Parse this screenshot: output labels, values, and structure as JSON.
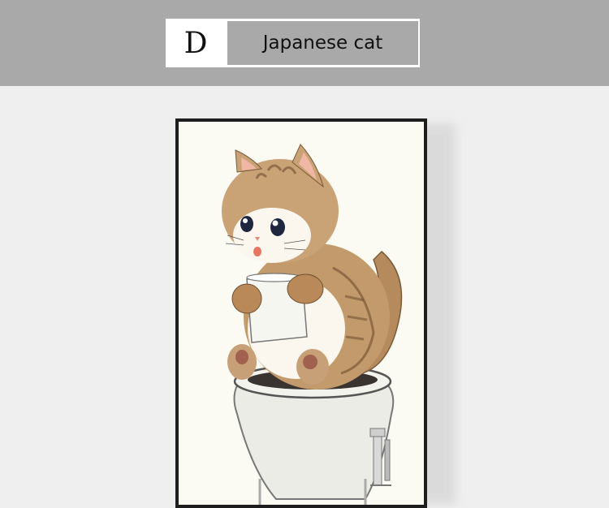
{
  "variant_label": {
    "letter": "D",
    "name": "Japanese cat"
  },
  "artwork": {
    "subject": "cat-on-toilet-illustration"
  },
  "colors": {
    "top_band": "#a9a9a9",
    "background": "#efefef",
    "frame": "#1d1d1d",
    "canvas": "#fbfaf3"
  }
}
